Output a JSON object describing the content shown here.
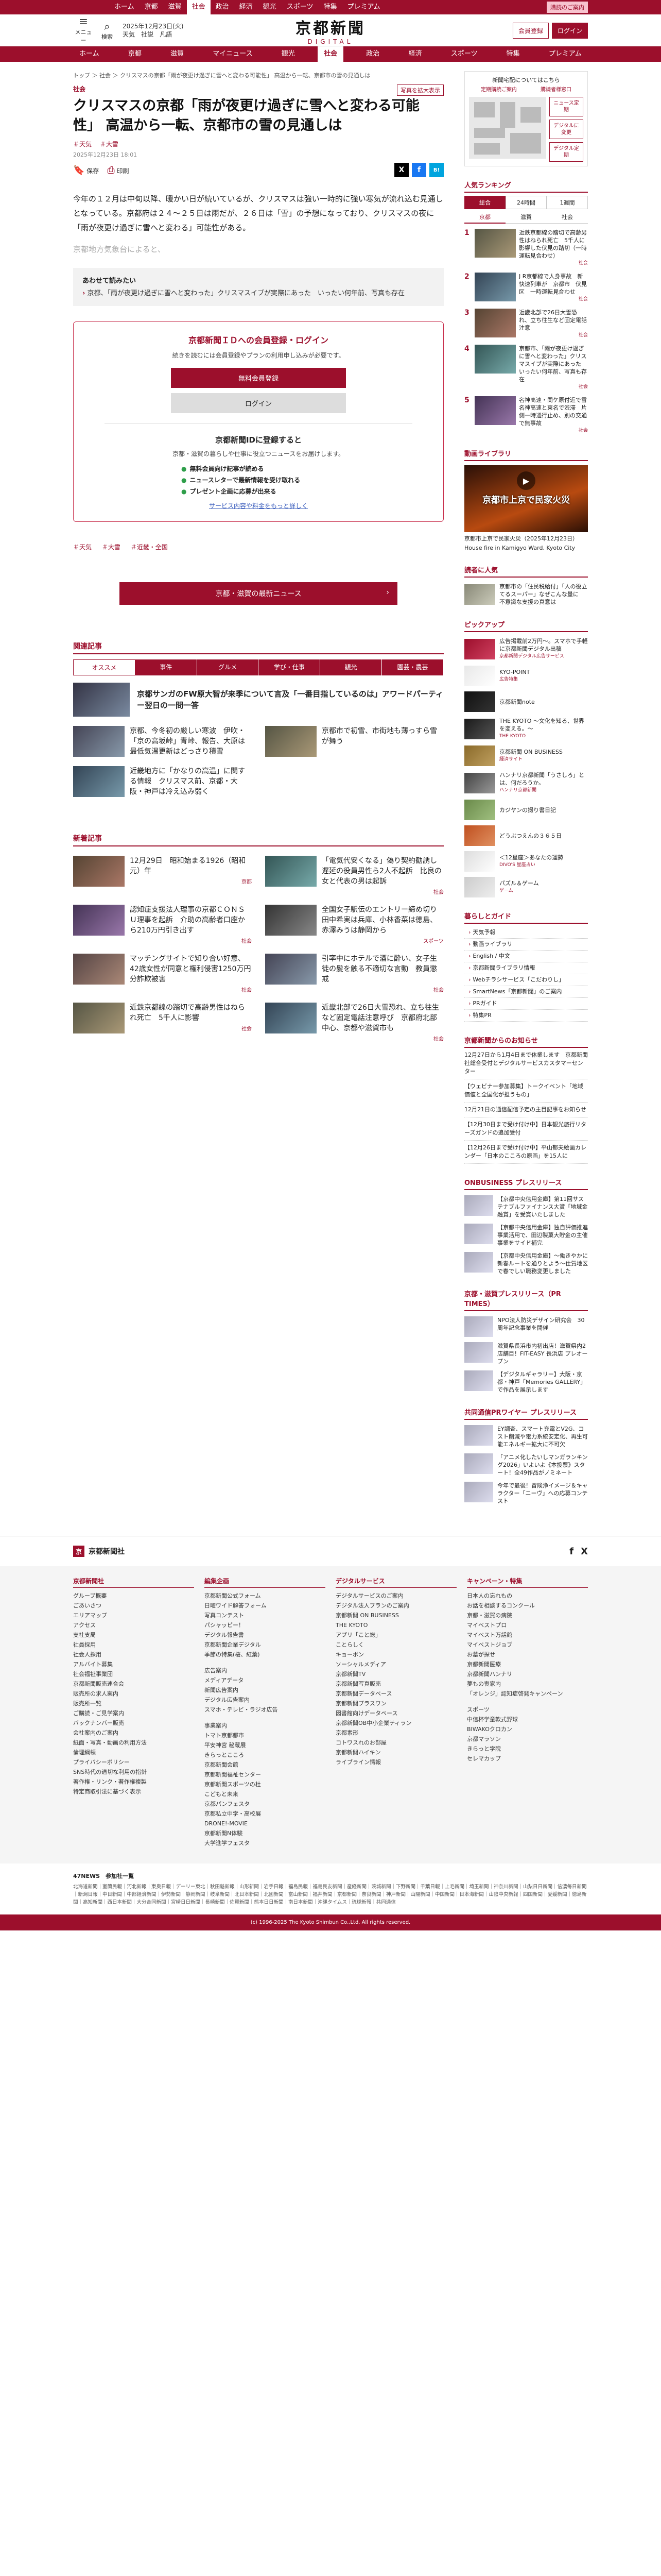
{
  "topnav": {
    "items": [
      "ホーム",
      "京都",
      "滋賀",
      "社会",
      "政治",
      "経済",
      "観光",
      "スポーツ",
      "特集",
      "プレミアム"
    ],
    "active_index": 3,
    "btn_subscribe": "購読のご案内",
    "btn_login": "ログイン"
  },
  "header": {
    "menu_label": "メニュー",
    "search_label": "検索",
    "date": "2025年12月23日(火)",
    "weather": "天気",
    "city": "社説",
    "col": "凡語",
    "logo": "京都新聞",
    "logo_sub": "DIGITAL",
    "btn_register": "会員登録",
    "btn_login": "ログイン"
  },
  "catnav": {
    "items": [
      "ホーム",
      "京都",
      "滋賀",
      "マイニュース",
      "観光",
      "社会",
      "政治",
      "経済",
      "スポーツ",
      "特集",
      "プレミアム"
    ],
    "active_index": 5
  },
  "breadcrumb": "トップ ＞ 社会 ＞ クリスマスの京都「雨が夜更け過ぎに雪へと変わる可能性」 高温から一転、京都市の雪の見通しは",
  "article": {
    "category": "社会",
    "photo_button": "写真を拡大表示",
    "title": "クリスマスの京都「雨が夜更け過ぎに雪へと変わる可能性」 高温から一転、京都市の雪の見通しは",
    "tags": [
      "＃天気",
      "＃大雪"
    ],
    "pubdate": "2025年12月23日 18:01",
    "tool_bookmark": "保存",
    "tool_print": "印刷",
    "share": [
      "X",
      "f",
      "B!"
    ],
    "paragraphs": [
      "今年の１２月は中旬以降、暖かい日が続いているが、クリスマスは強い一時的に強い寒気が流れ込む見通しとなっている。京都府は２４～２５日は雨だが、２６日は「雪」の予想になっており、クリスマスの夜に「雨が夜更け過ぎに雪へと変わる」可能性がある。"
    ],
    "faded": "京都地方気象台によると、",
    "also_read": {
      "heading": "あわせて読みたい",
      "item": "京都、「雨が夜更け過ぎに雪へと変わった」クリスマスイブが実際にあった　いったい何年前、写真も存在"
    },
    "reg": {
      "title": "京都新聞ＩＤへの会員登録・ログイン",
      "desc": "続きを読むには会員登録やプランの利用申し込みが必要です。",
      "btn_register": "無料会員登録",
      "btn_login": "ログイン",
      "sub_title": "京都新聞IDに登録すると",
      "sub_desc": "京都・滋賀の暮らしや仕事に役立つニュースをお届けします。",
      "benefits": [
        "無料会員向け記事が読める",
        "ニュースレターで最新情報を受け取れる",
        "プレゼント企画に応募が出来る"
      ],
      "more": "サービス内容や料金をもっと詳しく"
    },
    "bottom_tags": [
      "＃天気",
      "＃大雪",
      "＃近畿・全国"
    ],
    "latest_button": "京都・滋賀の最新ニュース"
  },
  "recommended": {
    "heading": "関連記事",
    "tabs": [
      "オススメ",
      "事件",
      "グルメ",
      "学び・仕事",
      "観光",
      "園芸・農芸"
    ],
    "active_tab": 0,
    "featured": "京都サンガのFW原大智が来季について言及「一番目指しているのは」アワードパーティー翌日の一問一答",
    "items": [
      {
        "t": "京都、今冬初の厳しい寒波　伊吹・「京の高坂峠」青峠、報告、大原は最低気温更新はどっさり積雪",
        "c": ""
      },
      {
        "t": "京都市で初雪、市街地も薄っすら雪が舞う",
        "c": ""
      },
      {
        "t": "近畿地方に「かなりの高温」に関する情報　クリスマス前、京都・大阪・神戸は冷え込み弱く",
        "c": ""
      }
    ]
  },
  "newest": {
    "heading": "新着記事",
    "items": [
      {
        "t": "12月29日　昭和始まる1926（昭和元）年",
        "c": "京都"
      },
      {
        "t": "「電気代安くなる」偽り契約勧誘し　遅延の役員男性ら2人不起訴　比良の女と代表の男は起訴",
        "c": "社会"
      },
      {
        "t": "認知症支援法人理事の京都ＣＯＮＳＵ理事を起訴　介助の高齢者口座から210万円引き出す",
        "c": "社会"
      },
      {
        "t": "全国女子駅伝のエントリー締め切り　田中希実は兵庫、小林香菜は徳島、赤澤みうは静岡から",
        "c": "スポーツ"
      },
      {
        "t": "マッチングサイトで知り合い好意、42歳女性が同意と権利侵害1250万円分詐欺被害",
        "c": "社会"
      },
      {
        "t": "引率中にホテルで酒に酔い、女子生徒の髪を触る不適切な言動　教員懲戒",
        "c": "社会"
      },
      {
        "t": "近鉄京都線の踏切で高齢男性はねられ死亡　5千人に影響",
        "c": "社会"
      },
      {
        "t": "近畿北部で26日大雪恐れ、立ち往生など固定電話注意呼び　京都府北部中心、京都や滋賀市も",
        "c": "社会"
      }
    ]
  },
  "sidebar": {
    "map": {
      "title": "新聞宅配についてはこちら",
      "links": [
        "定期購読ご案内",
        "購読者様窓口"
      ],
      "btns": [
        "ニュース定期",
        "デジタルに変更",
        "デジタル定期"
      ]
    },
    "ranking": {
      "heading": "人気ランキング",
      "tabs": [
        "総合",
        "24時間",
        "1週間"
      ],
      "active_tab": 0,
      "subtabs": [
        "京都",
        "滋賀",
        "社会"
      ],
      "active_sub": 0,
      "items": [
        {
          "t": "近鉄京都線の踏切で高齢男性はねられ死亡　5千人に影響した伏見の踏切（一時運転見合わせ）",
          "c": "社会"
        },
        {
          "t": "J R京都線で人身事故　新快速列車が　京都市　伏見区　一時運転見合わせ",
          "c": "社会"
        },
        {
          "t": "近畿北部で26日大雪恐れ、立ち往生など固定電話注意",
          "c": "社会"
        },
        {
          "t": "京都市、「雨が夜更け過ぎに雪へと変わった」クリスマスイブが実際にあった　いったい何年前、写真も存在",
          "c": "社会"
        },
        {
          "t": "名神高速・関ケ原付近で雪　名神高速と東名で渋滞　片側一時通行止め、別の交通で無事故",
          "c": "社会"
        }
      ]
    },
    "video": {
      "heading": "動画ライブラリ",
      "title": "京都市上京で民家火災",
      "caption": "House fire in Kamigyo Ward, Kyoto City",
      "overlay": "京都市上京で民家火災（2025年12月23日）"
    },
    "recommended_heading": "読者に人気",
    "reco_item": "京都市の「住民税給付」「人の役立てるスーパー」なぜこんな量に　不意識な支援の真意は",
    "pickup": {
      "heading": "ピックアップ",
      "items": [
        {
          "t": "広告掲載前2万円〜。スマホで手軽に京都新聞デジタル出稿",
          "l": "京都新聞デジタル広告サービス"
        },
        {
          "t": "KYO-POINT",
          "l": "広告特集"
        },
        {
          "t": "京都新聞note",
          "l": ""
        },
        {
          "t": "THE KYOTO 〜文化を知る、世界を変える。〜",
          "l": "THE KYOTO"
        },
        {
          "t": "京都新聞 ON BUSINESS",
          "l": "経済サイト"
        },
        {
          "t": "ハンナリ京都新聞「うさしろ」とは、何だろうか。",
          "l": "ハンナリ京都新聞"
        },
        {
          "t": "カジヤンの撮り書日記",
          "l": ""
        },
        {
          "t": "どうぶつえんの３６５日",
          "l": ""
        },
        {
          "t": "＜12星座＞あなたの運勢",
          "l": "DIVO'S 星座占い"
        },
        {
          "t": "パズル＆ゲーム",
          "l": "ゲーム"
        }
      ]
    },
    "links": {
      "heading": "暮らしとガイド",
      "items": [
        "天気予報",
        "動画ライブラリ",
        "English / 中文",
        "京都新聞ライブラリ情報",
        "Webチラシサービス「こだわりし」",
        "SmartNews「京都新聞」のご案内",
        "PRガイド",
        "特集PR"
      ]
    },
    "notices": {
      "heading": "京都新聞からのお知らせ",
      "items": [
        "12月27日から1月4日まで休業します　京都新聞社総合受付とデジタルサービスカスタマーセンター",
        "【ウェビナー参加募集】トークイベント「地域価値と全国化が担うもの」",
        "12月21日の通信配信予定の主目記事をお知らせ",
        "【12月30日まで受け付け中】日本観光旅行リターズガンドの追加受付",
        "【12月26日まで受け付け中】平山郁夫絵画カレンダー「日本のこころの原画」を15人に"
      ]
    },
    "onbiz": {
      "heading": "ONBUSINESS プレスリリース",
      "items": [
        "【京都中央信用金庫】第11回サステナブルファイナンス大賞「地域金融賞」を受賞いたしました",
        "【京都中央信用金庫】独自評価推進事業活用で、田辺製菓大貯金の主催事業をサイド補完",
        "【京都中央信用金庫】〜働きやかに新春ルートを通りとよう〜仕賀地区で春でしい職務変更しました"
      ]
    },
    "prtimes": {
      "heading": "京都・滋賀プレスリリース（PR TIMES）",
      "items": [
        "NPO法人防災デザイン研究会　30周年記念事業を開催",
        "滋賀県長浜市内初出店！滋賀県内2店舗目！FIT-EASY 長浜店 プレオープン",
        "【デジタルギャラリー】大阪・京都・神戸「Memories GALLERY」で作品を展示します"
      ]
    },
    "kyodo": {
      "heading": "共同通信PRワイヤー プレスリリース",
      "items": [
        "EY調査、スマート充電とV2G、コスト削減や電力系統安定化、再生可能エネルギー拡大に不可欠",
        "「アニメ化したいしマンガランキング2026」いよいよ《本投票》スタート！全49作品がノミネート",
        "今年で最後！冒険浄イメージ＆キャラクター「ニーヴ」への応募コンテスト"
      ]
    }
  },
  "footer": {
    "brand": "京都新聞社",
    "social": [
      "f",
      "X"
    ],
    "cols": [
      {
        "h": "京都新聞社",
        "items": [
          "グループ概要",
          "ごあいさつ",
          "エリアマップ",
          "アクセス",
          "支社支局",
          "社員採用",
          "社会人採用",
          "アルバイト募集",
          "社会福祉事業団",
          "京都新聞販売連合会",
          "販売所の求人案内",
          "販売所一覧",
          "ご購読・ご見学案内",
          "バックナンバー販売",
          "会社案内のご案内",
          "紙面・写真・動画の利用方法",
          "倫理綱領",
          "プライバシーポリシー",
          "SNS時代の適切な利用の指針",
          "著作権・リンク・著作権複製",
          "特定商取引法に基づく表示"
        ]
      },
      {
        "h": "編集企画",
        "items": [
          "京都新聞公式フォーム",
          "日曜ワイド解答フォーム",
          "写真コンテスト",
          "パシャッピー！",
          "デジタル報告書",
          "京都新聞企業デジタル",
          "季節の特集(桜、紅葉)",
          "",
          "広告案内",
          "メディアデータ",
          "新聞広告案内",
          "デジタル広告案内",
          "スマホ・テレビ・ラジオ広告",
          "",
          "事業案内",
          "トマト京都都市",
          "平安神宮 秘蔵展",
          "きらっとこころ",
          "京都新聞会館",
          "京都新聞福祉センター",
          "京都新聞スポーツの杜",
          "こどもと未来",
          "京都パンフェスタ",
          "京都私立中学・高校展",
          "DRONE!-MOVIE",
          "京都新聞N体験",
          "大学進学フェスタ"
        ]
      },
      {
        "h": "デジタルサービス",
        "items": [
          "デジタルサービスのご案内",
          "デジタル法人プランのご案内",
          "京都新聞 ON BUSINESS",
          "THE KYOTO",
          "アプリ「こと総」",
          "ことらしく",
          "キョーボン",
          "ソーシャルメディア",
          "京都新聞TV",
          "京都新聞写真販売",
          "京都新聞データベース",
          "京都新聞プラスワン",
          "図書館向けデータベース",
          "京都新聞OB中小企業ティラン",
          "京都素形",
          "コトワスれのお部屋",
          "京都新聞ハイキン",
          "ライブライン情報"
        ]
      },
      {
        "h": "キャンペーン・特集",
        "items": [
          "日本人の忘れもの",
          "お話を相談するコンクール",
          "京都・滋賀の病院",
          "マイベストプロ",
          "マイベスト万話館",
          "マイベストジョブ",
          "お墓が探せ",
          "京都新聞医療",
          "京都新聞ハンナリ",
          "夢もの喪家内",
          "「オレンジ」認知症啓発キャンペーン",
          "",
          "スポーツ",
          "中信杯学童軟式野球",
          "BIWAKOクロカン",
          "京都マラソン",
          "きらっと学院",
          "セレマカップ"
        ]
      }
    ],
    "n47_head": "47NEWS　参加社一覧",
    "n47_names": "北海道新聞｜室蘭民報｜河北新報｜東奥日報｜デーリー東北｜秋田魁新報｜山形新聞｜岩手日報｜福島民報｜福島民友新聞｜産経新聞｜茨城新聞｜下野新聞｜千葉日報｜上毛新聞｜埼玉新聞｜神奈川新聞｜山梨日日新聞｜信濃毎日新聞｜新潟日報｜中日新聞｜中部経済新聞｜伊勢新聞｜静岡新聞｜岐阜新聞｜北日本新聞｜北國新聞｜富山新聞｜福井新聞｜京都新聞｜奈良新聞｜神戸新聞｜山陽新聞｜中国新聞｜日本海新聞｜山陰中央新報｜四国新聞｜愛媛新聞｜徳島新聞｜高知新聞｜西日本新聞｜大分合同新聞｜宮崎日日新聞｜長崎新聞｜佐賀新聞｜熊本日日新聞｜南日本新聞｜沖縄タイムス｜琉球新報｜共同通信",
    "copyright": "(c) 1996-2025 The Kyoto Shimbun Co.,Ltd. All rights reserved."
  },
  "colors": {
    "brand": "#9c0f2c"
  }
}
